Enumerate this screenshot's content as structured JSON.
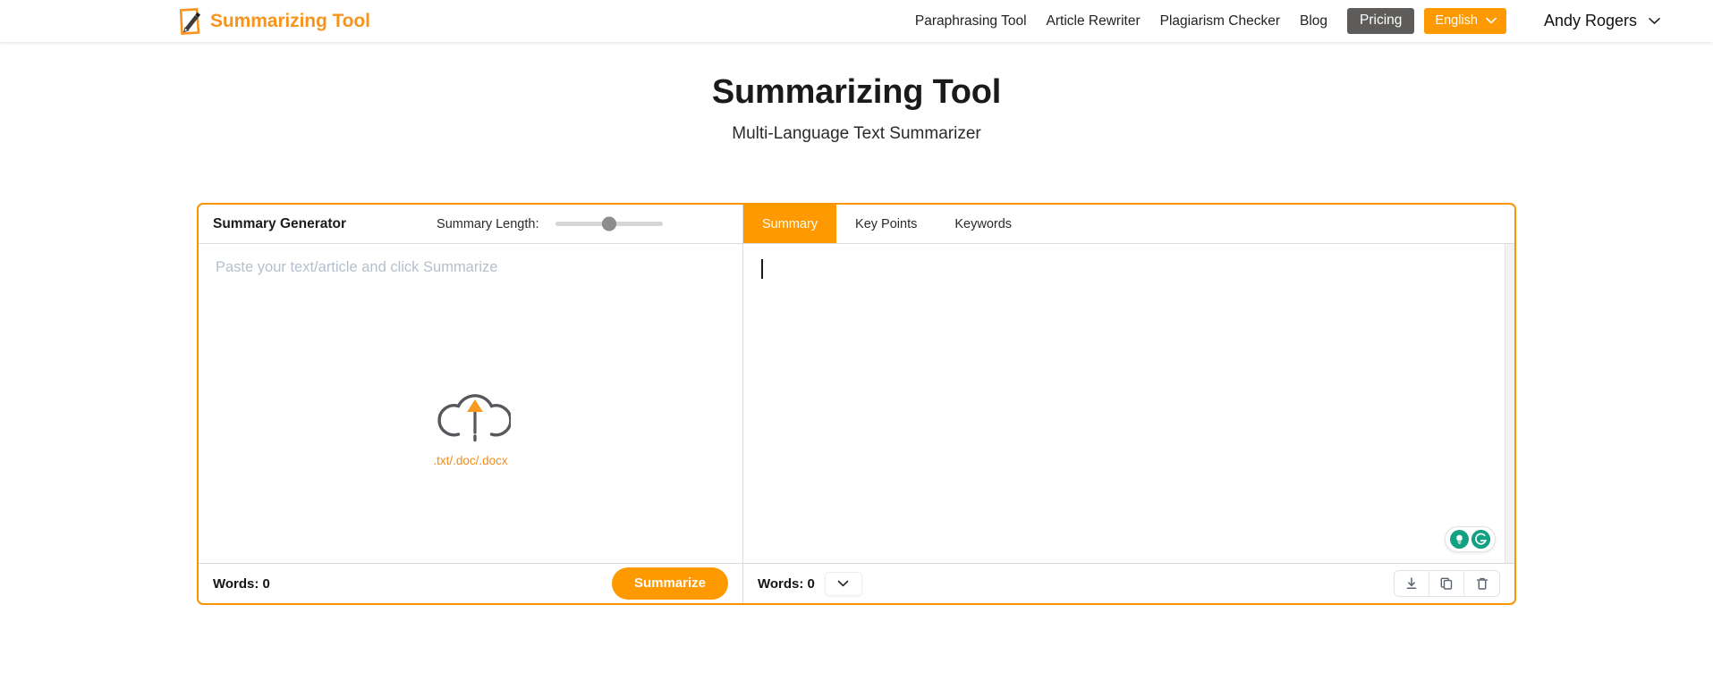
{
  "header": {
    "brand": {
      "name": "Summarizing Tool",
      "icon": "pen-paper-logo-icon",
      "color": "#F7941D"
    },
    "nav": [
      {
        "label": "Paraphrasing Tool",
        "name": "nav-paraphrasing-tool"
      },
      {
        "label": "Article Rewriter",
        "name": "nav-article-rewriter"
      },
      {
        "label": "Plagiarism Checker",
        "name": "nav-plagiarism-checker"
      },
      {
        "label": "Blog",
        "name": "nav-blog"
      }
    ],
    "pricing_label": "Pricing",
    "language_label": "English",
    "user_name": "Andy Rogers"
  },
  "page": {
    "title": "Summarizing Tool",
    "subtitle": "Multi-Language Text Summarizer"
  },
  "tool": {
    "left": {
      "generator_title": "Summary Generator",
      "length_label": "Summary Length:",
      "slider_value": 50,
      "placeholder": "Paste your text/article and click Summarize",
      "dropzone_caption": ".txt/.doc/.docx",
      "words_label": "Words: 0",
      "summarize_label": "Summarize"
    },
    "right": {
      "tabs": [
        {
          "label": "Summary",
          "active": true
        },
        {
          "label": "Key Points",
          "active": false
        },
        {
          "label": "Keywords",
          "active": false
        }
      ],
      "content": "",
      "words_label": "Words: 0",
      "actions": [
        {
          "name": "download-icon",
          "title": "Download"
        },
        {
          "name": "copy-icon",
          "title": "Copy"
        },
        {
          "name": "delete-icon",
          "title": "Delete"
        }
      ]
    },
    "grammarly": {
      "bulb": "lightbulb-icon",
      "logo": "grammarly-g-icon",
      "color": "#12a182"
    }
  },
  "colors": {
    "accent": "#FF9900",
    "brand": "#F7941D",
    "pricing_bg": "#5e5c5a"
  }
}
